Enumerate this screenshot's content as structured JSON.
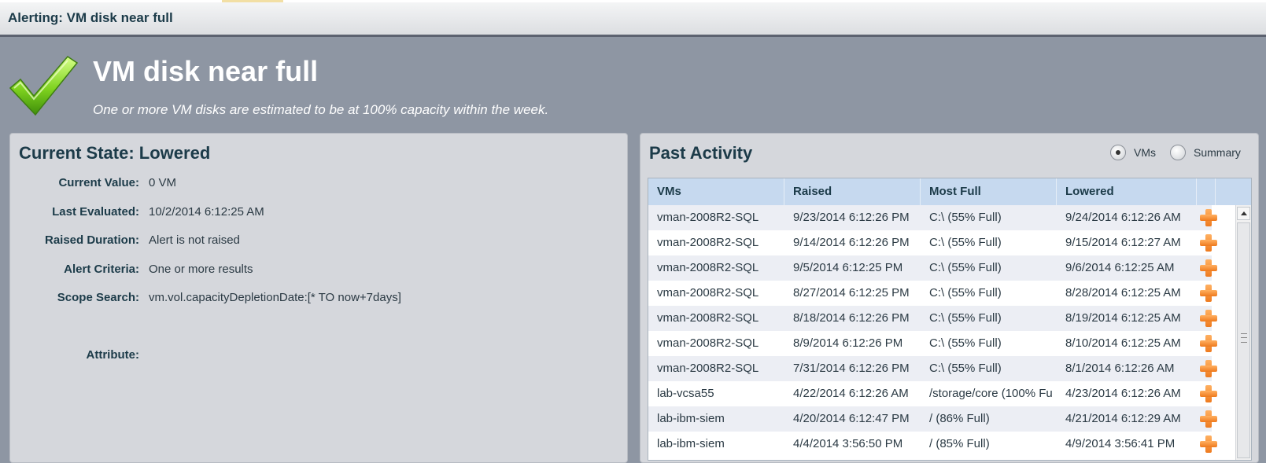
{
  "window": {
    "title": "Alerting: VM disk near full"
  },
  "alert": {
    "name": "VM disk near full",
    "description": "One or more VM disks are estimated to be at 100% capacity within the week."
  },
  "current_state": {
    "title": "Current State: Lowered",
    "fields": [
      {
        "label": "Current Value:",
        "value": "0 VM"
      },
      {
        "label": "Last Evaluated:",
        "value": "10/2/2014 6:12:25 AM"
      },
      {
        "label": "Raised Duration:",
        "value": "Alert is not raised"
      },
      {
        "label": "Alert Criteria:",
        "value": "One or more results"
      },
      {
        "label": "Scope Search:",
        "value": "vm.vol.capacityDepletionDate:[* TO now+7days]"
      },
      {
        "label": "Attribute:",
        "value": ""
      }
    ]
  },
  "past_activity": {
    "title": "Past Activity",
    "view_options": [
      {
        "label": "VMs",
        "selected": true
      },
      {
        "label": "Summary",
        "selected": false
      }
    ],
    "columns": [
      "VMs",
      "Raised",
      "Most Full",
      "Lowered"
    ],
    "rows": [
      [
        "vman-2008R2-SQL",
        "9/23/2014 6:12:26 PM",
        "C:\\ (55% Full)",
        "9/24/2014 6:12:26 AM"
      ],
      [
        "vman-2008R2-SQL",
        "9/14/2014 6:12:26 PM",
        "C:\\ (55% Full)",
        "9/15/2014 6:12:27 AM"
      ],
      [
        "vman-2008R2-SQL",
        "9/5/2014 6:12:25 PM",
        "C:\\ (55% Full)",
        "9/6/2014 6:12:25 AM"
      ],
      [
        "vman-2008R2-SQL",
        "8/27/2014 6:12:25 PM",
        "C:\\ (55% Full)",
        "8/28/2014 6:12:25 AM"
      ],
      [
        "vman-2008R2-SQL",
        "8/18/2014 6:12:26 PM",
        "C:\\ (55% Full)",
        "8/19/2014 6:12:25 AM"
      ],
      [
        "vman-2008R2-SQL",
        "8/9/2014 6:12:26 PM",
        "C:\\ (55% Full)",
        "8/10/2014 6:12:25 AM"
      ],
      [
        "vman-2008R2-SQL",
        "7/31/2014 6:12:26 PM",
        "C:\\ (55% Full)",
        "8/1/2014 6:12:26 AM"
      ],
      [
        "lab-vcsa55",
        "4/22/2014 6:12:26 AM",
        "/storage/core (100% Fu",
        "4/23/2014 6:12:26 AM"
      ],
      [
        "lab-ibm-siem",
        "4/20/2014 6:12:47 PM",
        "/ (86% Full)",
        "4/21/2014 6:12:29 AM"
      ],
      [
        "lab-ibm-siem",
        "4/4/2014 3:56:50 PM",
        "/ (85% Full)",
        "4/9/2014 3:56:41 PM"
      ]
    ]
  },
  "icons": {
    "status": "checkmark-icon",
    "row_action": "plus-icon",
    "accent_green": "#7fd31f",
    "action_orange": "#f0801f"
  }
}
